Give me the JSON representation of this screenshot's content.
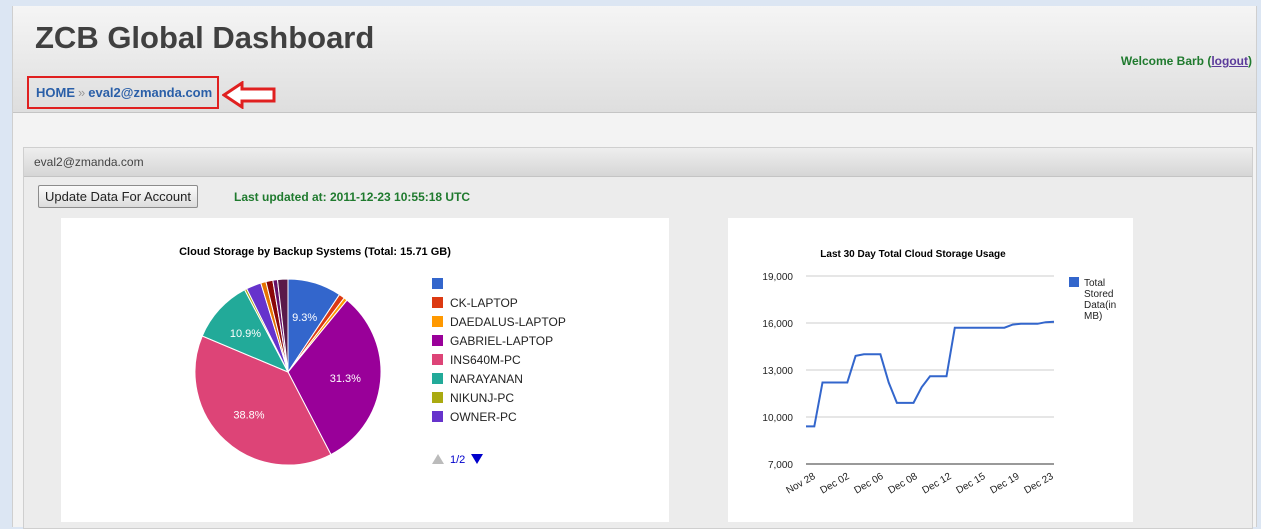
{
  "header": {
    "title": "ZCB Global Dashboard",
    "welcome_text": "Welcome Barb (",
    "logout_label": "logout",
    "welcome_close": ")"
  },
  "breadcrumb": {
    "home": "HOME",
    "separator": "»",
    "current": "eval2@zmanda.com"
  },
  "panel": {
    "title": "eval2@zmanda.com",
    "update_button": "Update Data For Account",
    "last_updated": "Last updated at: 2011-12-23 10:55:18 UTC"
  },
  "colors": {
    "accent": "#2a5fa8",
    "status_green": "#1f7a2e",
    "annotation_red": "#e02020"
  },
  "chart_data": [
    {
      "type": "pie",
      "title": "Cloud Storage by Backup Systems (Total: 15.71 GB)",
      "slices": [
        {
          "label": "",
          "value": 9.3,
          "color": "#3366cc",
          "data_label": "9.3%"
        },
        {
          "label": "CK-LAPTOP",
          "value": 1.0,
          "color": "#dc3912"
        },
        {
          "label": "DAEDALUS-LAPTOP",
          "value": 0.6,
          "color": "#ff9900"
        },
        {
          "label": "GABRIEL-LAPTOP",
          "value": 31.3,
          "color": "#990099",
          "data_label": "31.3%"
        },
        {
          "label": "INS640M-PC",
          "value": 38.8,
          "color": "#dd4477",
          "data_label": "38.8%"
        },
        {
          "label": "NARAYANAN",
          "value": 10.9,
          "color": "#22aa99",
          "data_label": "10.9%"
        },
        {
          "label": "NIKUNJ-PC",
          "value": 0.4,
          "color": "#aaaa11"
        },
        {
          "label": "OWNER-PC",
          "value": 2.6,
          "color": "#6633cc"
        },
        {
          "label": "",
          "value": 0.9,
          "color": "#e67300"
        },
        {
          "label": "",
          "value": 1.2,
          "color": "#8b0707"
        },
        {
          "label": "",
          "value": 0.8,
          "color": "#651067"
        },
        {
          "label": "",
          "value": 1.8,
          "color": "#5a1a4a"
        }
      ],
      "legend_entries": 8,
      "legend_pager": "1/2",
      "legend_position": "right"
    },
    {
      "type": "line",
      "title": "Last 30 Day Total Cloud Storage Usage",
      "series": [
        {
          "name": "Total Stored Data(in MB)",
          "color": "#3366cc",
          "values": [
            9400,
            9400,
            12200,
            12200,
            12200,
            12200,
            13900,
            14000,
            14000,
            14000,
            12200,
            10900,
            10900,
            10900,
            11900,
            12600,
            12600,
            12600,
            15700,
            15700,
            15700,
            15700,
            15700,
            15700,
            15700,
            15900,
            15950,
            15950,
            15950,
            16050,
            16080
          ]
        }
      ],
      "x_tick_labels": [
        "Nov 28",
        "Dec 02",
        "Dec 06",
        "Dec 08",
        "Dec 12",
        "Dec 15",
        "Dec 19",
        "Dec 23"
      ],
      "y_ticks": [
        "19,000",
        "16,000",
        "13,000",
        "10,000",
        "7,000"
      ],
      "ylim": [
        7000,
        19000
      ],
      "legend_lines": [
        "Total",
        "Stored",
        "Data(in",
        "MB)"
      ],
      "legend_position": "right",
      "grid": true
    }
  ]
}
